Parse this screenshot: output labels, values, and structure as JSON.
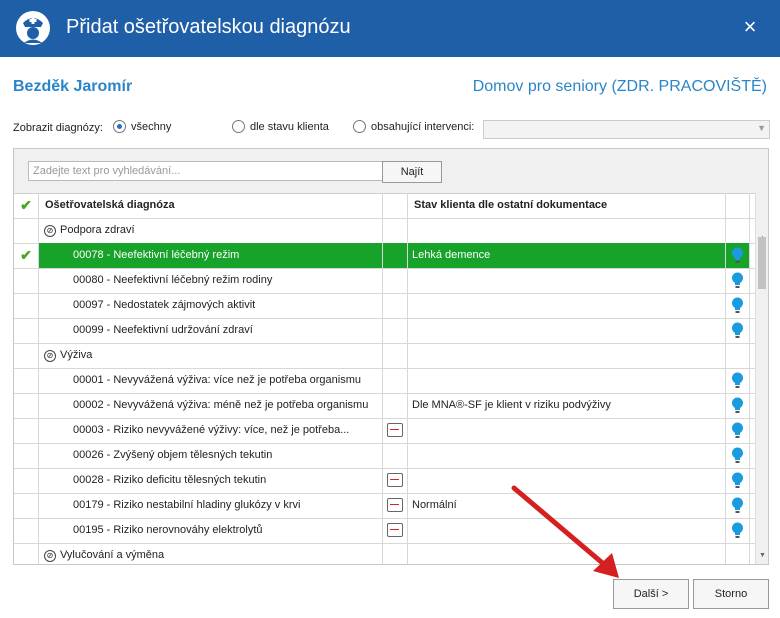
{
  "window": {
    "title": "Přidat ošetřovatelskou diagnózu",
    "close_glyph": "×",
    "logo_icon": "nurse-icon"
  },
  "patient": {
    "name": "Bezděk Jaromír",
    "facility": "Domov pro seniory (ZDR. PRACOVIŠTĚ)"
  },
  "filter": {
    "label": "Zobrazit diagnózy:",
    "options": [
      {
        "label": "všechny",
        "selected": true
      },
      {
        "label": "dle stavu klienta",
        "selected": false
      },
      {
        "label": "obsahující intervenci:",
        "selected": false
      }
    ],
    "intervention_value": ""
  },
  "search": {
    "placeholder": "Zadejte text pro vyhledávání...",
    "value": "",
    "button": "Najít"
  },
  "table": {
    "headers": {
      "diagnosis": "Ošetřovatelská diagnóza",
      "status": "Stav klienta dle ostatní dokumentace"
    },
    "rows": [
      {
        "type": "group",
        "label": "Podpora zdraví",
        "expander": "⊘"
      },
      {
        "type": "item",
        "label": "00078 - Neefektivní léčebný režim",
        "status": "Lehká demence",
        "selected": true,
        "checked": true,
        "monitor": false,
        "bulb": true
      },
      {
        "type": "item",
        "label": "00080 - Neefektivní léčebný režim rodiny",
        "status": "",
        "selected": false,
        "checked": false,
        "monitor": false,
        "bulb": true
      },
      {
        "type": "item",
        "label": "00097 - Nedostatek zájmových aktivit",
        "status": "",
        "selected": false,
        "checked": false,
        "monitor": false,
        "bulb": true
      },
      {
        "type": "item",
        "label": "00099 - Neefektivní udržování zdraví",
        "status": "",
        "selected": false,
        "checked": false,
        "monitor": false,
        "bulb": true
      },
      {
        "type": "group",
        "label": "Výživa",
        "expander": "⊘"
      },
      {
        "type": "item",
        "label": "00001 - Nevyvážená výživa: více než je potřeba organismu",
        "status": "",
        "selected": false,
        "checked": false,
        "monitor": false,
        "bulb": true
      },
      {
        "type": "item",
        "label": "00002 - Nevyvážená výživa: méně než je potřeba organismu",
        "status": "Dle MNA®-SF je klient v riziku podvýživy",
        "selected": false,
        "checked": false,
        "monitor": false,
        "bulb": true
      },
      {
        "type": "item",
        "label": "00003 - Riziko nevyvážené výživy: více, než je potřeba...",
        "status": "",
        "selected": false,
        "checked": false,
        "monitor": true,
        "bulb": true
      },
      {
        "type": "item",
        "label": "00026 - Zvýšený objem tělesných tekutin",
        "status": "",
        "selected": false,
        "checked": false,
        "monitor": false,
        "bulb": true
      },
      {
        "type": "item",
        "label": "00028 - Riziko deficitu tělesných tekutin",
        "status": "",
        "selected": false,
        "checked": false,
        "monitor": true,
        "bulb": true
      },
      {
        "type": "item",
        "label": "00179 - Riziko nestabilní hladiny glukózy v krvi",
        "status": "Normální",
        "selected": false,
        "checked": false,
        "monitor": true,
        "bulb": true
      },
      {
        "type": "item",
        "label": "00195 - Riziko nerovnováhy elektrolytů",
        "status": "",
        "selected": false,
        "checked": false,
        "monitor": true,
        "bulb": true
      },
      {
        "type": "group",
        "label": "Vylučování a výměna",
        "expander": "⊘"
      }
    ]
  },
  "buttons": {
    "next": "Další >",
    "cancel": "Storno"
  },
  "colors": {
    "titlebar": "#1f5fa8",
    "accent": "#2a86c8",
    "selected_row": "#17a22a",
    "check": "#48a424",
    "annotation_arrow": "#d42020"
  }
}
